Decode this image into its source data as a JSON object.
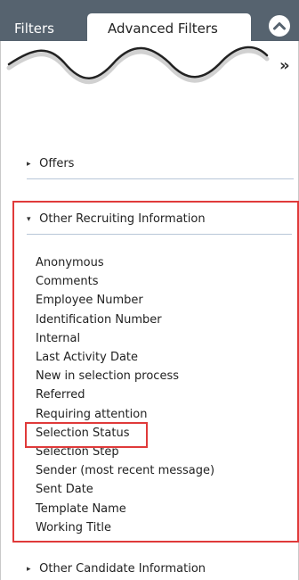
{
  "tabs": {
    "filters_label": "Filters",
    "advanced_label": "Advanced Filters"
  },
  "icons": {
    "collapse": "chevron-up-icon",
    "expand": "double-chevron-right-icon"
  },
  "sections": {
    "offers": {
      "label": "Offers",
      "caret": "▸"
    },
    "other_recruiting": {
      "label": "Other Recruiting Information",
      "caret": "▾"
    },
    "other_candidate": {
      "label": "Other Candidate Information",
      "caret": "▸"
    }
  },
  "recruiting_fields": [
    "Anonymous",
    "Comments",
    "Employee Number",
    "Identification Number",
    "Internal",
    "Last Activity Date",
    "New in selection process",
    "Referred",
    "Requiring attention",
    "Selection Status",
    "Selection Step",
    "Sender (most recent message)",
    "Sent Date",
    "Template Name",
    "Working Title"
  ],
  "colors": {
    "header": "#56636f",
    "highlight": "#e03a3a",
    "divider": "#b8c6d8"
  }
}
